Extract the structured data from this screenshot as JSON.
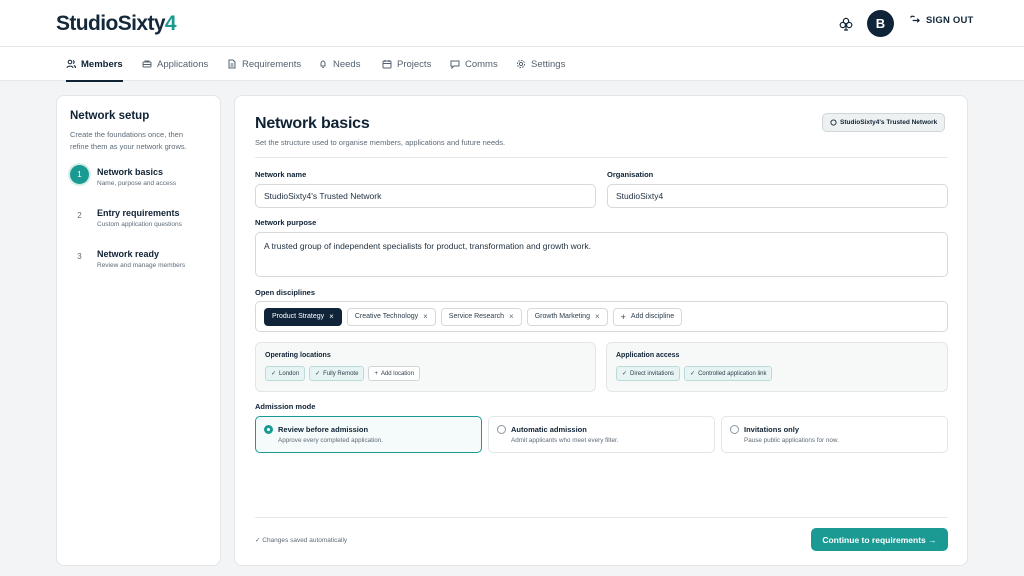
{
  "brand": {
    "name_main": "StudioSixty",
    "name_accent": "4"
  },
  "header": {
    "avatar_initial": "B",
    "signout_label": "SIGN OUT"
  },
  "nav": {
    "items": [
      {
        "label": "Members",
        "icon": "users-icon",
        "active": true
      },
      {
        "label": "Applications",
        "icon": "inbox-icon"
      },
      {
        "label": "Requirements",
        "icon": "document-icon"
      },
      {
        "label": "Needs",
        "icon": "bell-icon"
      },
      {
        "label": "Projects",
        "icon": "calendar-icon"
      },
      {
        "label": "Comms",
        "icon": "chat-icon"
      },
      {
        "label": "Settings",
        "icon": "gear-icon"
      }
    ]
  },
  "sidebar": {
    "title": "Network setup",
    "description": "Create the foundations once, then refine them as your network grows.",
    "steps": [
      {
        "num": "1",
        "title": "Network basics",
        "sub": "Name, purpose and access"
      },
      {
        "num": "2",
        "title": "Entry requirements",
        "sub": "Custom application questions"
      },
      {
        "num": "3",
        "title": "Network ready",
        "sub": "Review and manage members"
      }
    ]
  },
  "main": {
    "title": "Network basics",
    "subtitle": "Set the structure used to organise members, applications and future needs.",
    "badge": "StudioSixty4's Trusted Network",
    "network_name_label": "Network name",
    "network_name_value": "StudioSixty4's Trusted Network",
    "organisation_label": "Organisation",
    "organisation_value": "StudioSixty4",
    "purpose_label": "Network purpose",
    "purpose_value": "A trusted group of independent specialists for product, transformation and growth work.",
    "disciplines_label": "Open disciplines",
    "disciplines": [
      "Product Strategy",
      "Creative Technology",
      "Service Research",
      "Growth Marketing"
    ],
    "add_discipline": "Add discipline",
    "locations_label": "Operating locations",
    "locations": [
      "London",
      "Fully Remote"
    ],
    "add_location": "Add location",
    "access_label": "Application access",
    "access": [
      "Direct invitations",
      "Controlled application link"
    ],
    "admission_label": "Admission mode",
    "admission_options": [
      {
        "title": "Review before admission",
        "sub": "Approve every completed application.",
        "selected": true
      },
      {
        "title": "Automatic admission",
        "sub": "Admit applicants who meet every filter.",
        "selected": false
      },
      {
        "title": "Invitations only",
        "sub": "Pause public applications for now.",
        "selected": false
      }
    ],
    "saved_note": "✓ Changes saved automatically",
    "continue_label": "Continue to requirements →"
  },
  "colors": {
    "accent": "#1a9a92",
    "navy": "#0f2438"
  }
}
